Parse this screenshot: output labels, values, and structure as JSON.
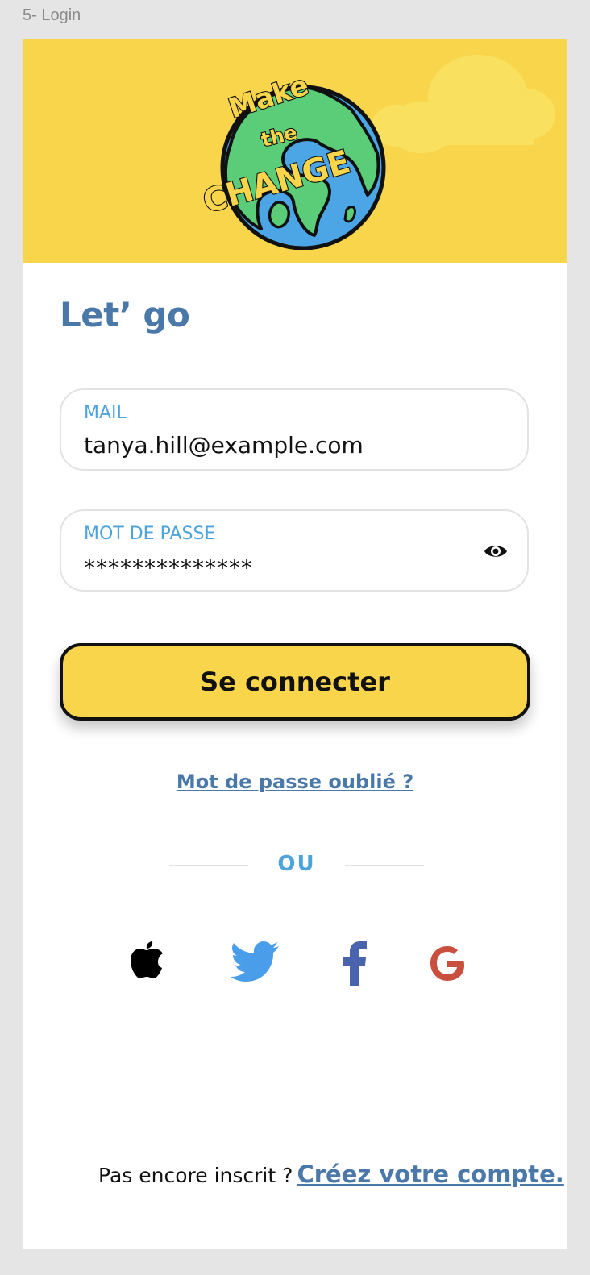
{
  "frame_label": "5- Login",
  "logo": {
    "line1": "Make",
    "line2": "the",
    "line3": "CHANGE"
  },
  "title": "Let’ go",
  "email": {
    "label": "MAIL",
    "value": "tanya.hill@example.com"
  },
  "password": {
    "label": "MOT DE PASSE",
    "value": "**************"
  },
  "login_button": "Se connecter",
  "forgot_link": "Mot de passe oublié ?",
  "divider_text": "OU",
  "social": [
    "apple-icon",
    "twitter-icon",
    "facebook-icon",
    "google-icon"
  ],
  "signup": {
    "question": "Pas encore inscrit ?",
    "link": "Créez votre compte."
  },
  "colors": {
    "background": "#e5e5e5",
    "accent_yellow": "#f8d54a",
    "title_blue": "#4a78a8",
    "label_blue": "#4da3dc",
    "twitter": "#4a9de8",
    "facebook": "#4a63ad",
    "google": "#c9503f"
  }
}
